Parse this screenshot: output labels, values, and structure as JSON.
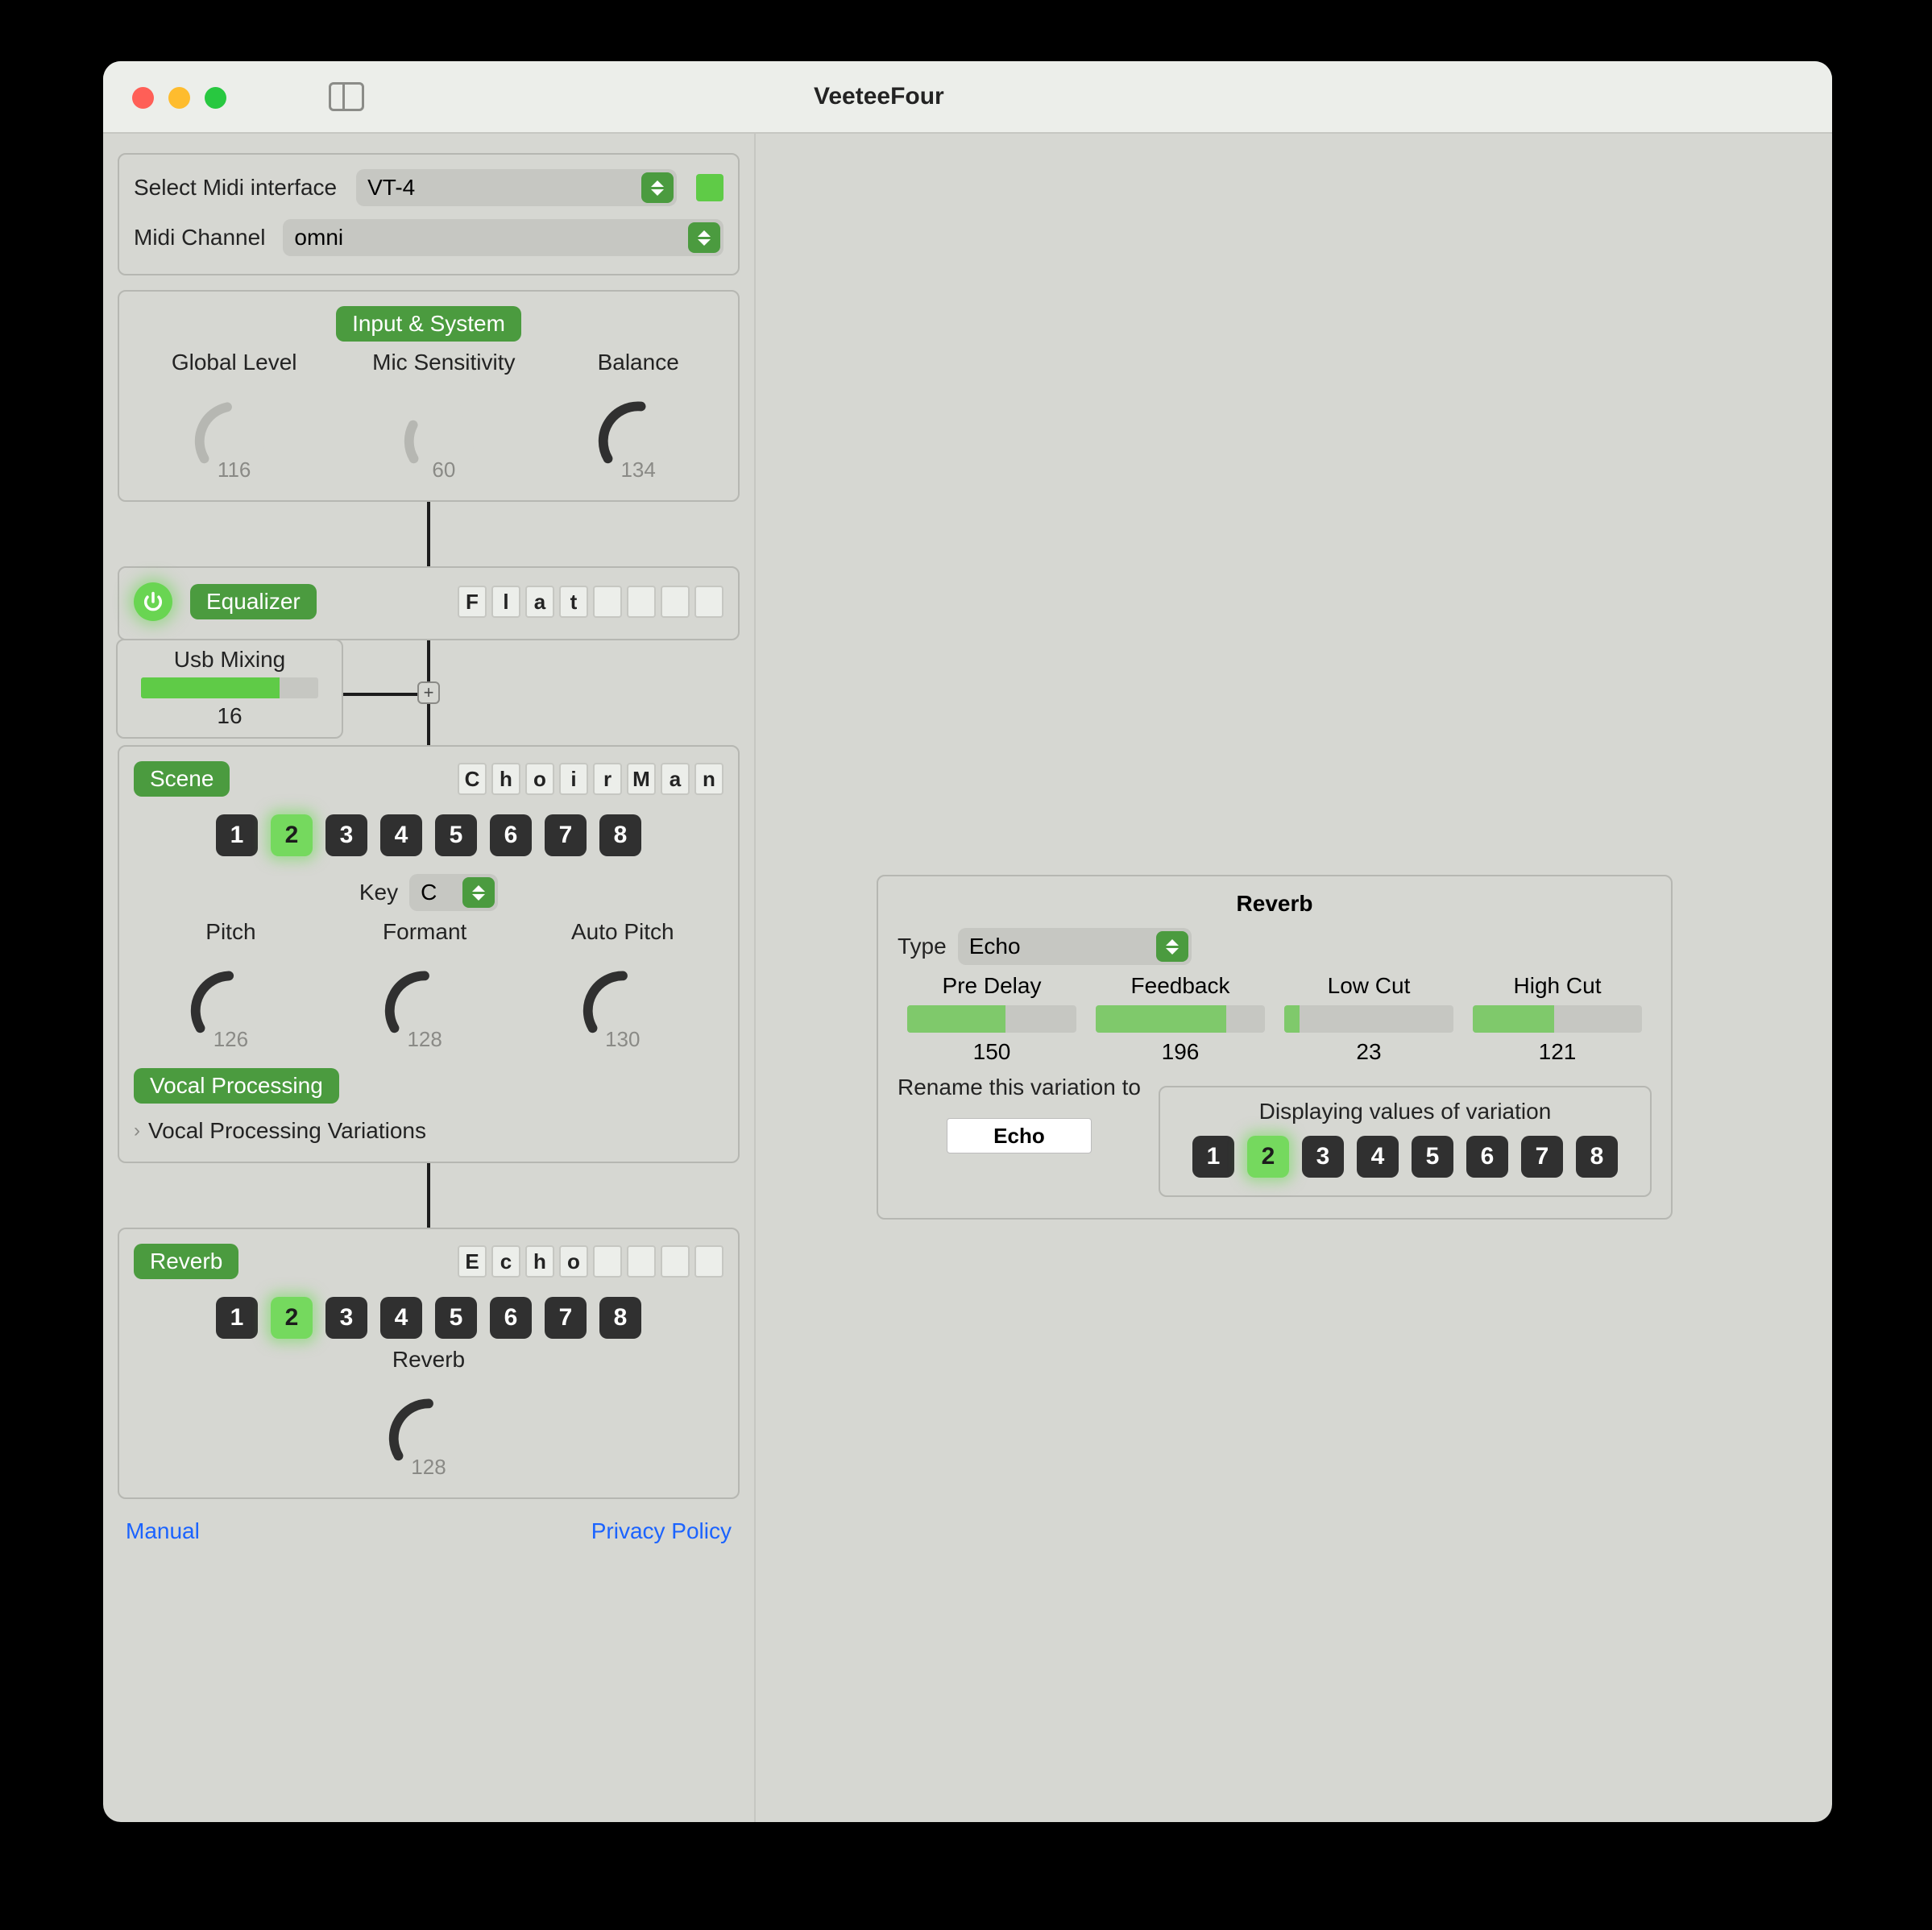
{
  "app_title": "VeeteeFour",
  "midi": {
    "select_label": "Select Midi interface",
    "interface_value": "VT-4",
    "channel_label": "Midi Channel",
    "channel_value": "omni"
  },
  "input_system": {
    "badge": "Input & System",
    "knobs": [
      {
        "label": "Global Level",
        "value": "116",
        "pct": 45,
        "color": "#b6b7b2"
      },
      {
        "label": "Mic Sensitivity",
        "value": "60",
        "pct": 24,
        "color": "#b6b7b2"
      },
      {
        "label": "Balance",
        "value": "134",
        "pct": 52,
        "color": "#303030"
      }
    ]
  },
  "equalizer": {
    "badge": "Equalizer",
    "name_letters": [
      "F",
      "l",
      "a",
      "t",
      "",
      "",
      "",
      ""
    ]
  },
  "usb_mixing": {
    "label": "Usb Mixing",
    "value": "16",
    "fill_pct": 78
  },
  "scene": {
    "badge": "Scene",
    "name_letters": [
      "C",
      "h",
      "o",
      "i",
      "r",
      "M",
      "a",
      "n"
    ],
    "buttons": [
      "1",
      "2",
      "3",
      "4",
      "5",
      "6",
      "7",
      "8"
    ],
    "active": 2,
    "key_label": "Key",
    "key_value": "C",
    "knobs": [
      {
        "label": "Pitch",
        "value": "126",
        "pct": 49,
        "color": "#303030"
      },
      {
        "label": "Formant",
        "value": "128",
        "pct": 50,
        "color": "#303030"
      },
      {
        "label": "Auto Pitch",
        "value": "130",
        "pct": 50,
        "color": "#303030"
      }
    ],
    "vp_badge": "Vocal Processing",
    "vp_disclosure": "Vocal Processing Variations"
  },
  "reverb_left": {
    "badge": "Reverb",
    "name_letters": [
      "E",
      "c",
      "h",
      "o",
      "",
      "",
      "",
      ""
    ],
    "buttons": [
      "1",
      "2",
      "3",
      "4",
      "5",
      "6",
      "7",
      "8"
    ],
    "active": 2,
    "knob": {
      "label": "Reverb",
      "value": "128",
      "pct": 50,
      "color": "#303030"
    }
  },
  "footer": {
    "manual": "Manual",
    "privacy": "Privacy Policy"
  },
  "detail": {
    "title": "Reverb",
    "type_label": "Type",
    "type_value": "Echo",
    "sliders": [
      {
        "label": "Pre Delay",
        "value": "150",
        "pct": 58
      },
      {
        "label": "Feedback",
        "value": "196",
        "pct": 77
      },
      {
        "label": "Low Cut",
        "value": "23",
        "pct": 9
      },
      {
        "label": "High Cut",
        "value": "121",
        "pct": 48
      }
    ],
    "rename_label": "Rename this variation to",
    "rename_value": "Echo",
    "var_label": "Displaying values of variation",
    "var_buttons": [
      "1",
      "2",
      "3",
      "4",
      "5",
      "6",
      "7",
      "8"
    ],
    "var_active": 2
  }
}
